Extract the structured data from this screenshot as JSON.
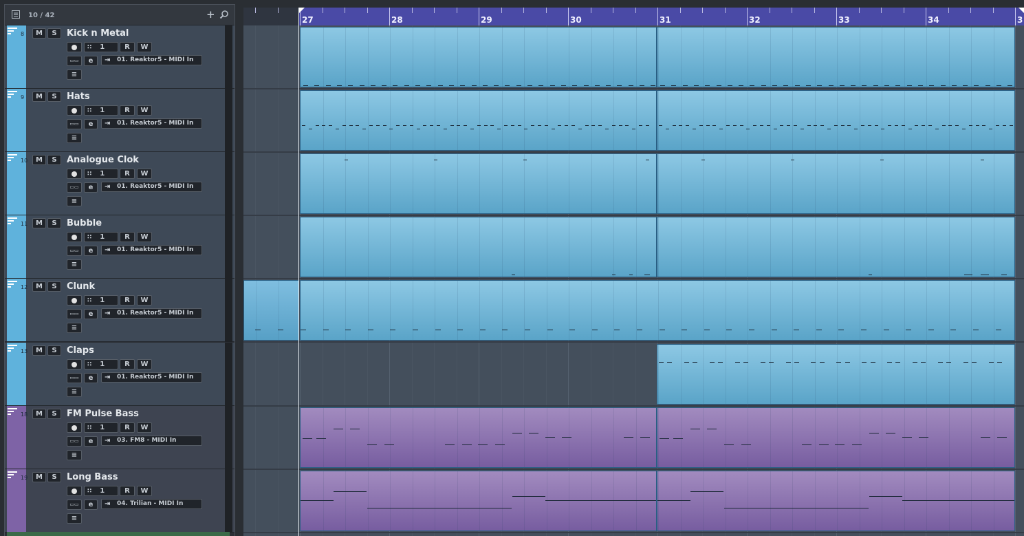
{
  "tracklist": {
    "count": "10 / 42",
    "add_icon": "plus-icon",
    "search_icon": "search-icon",
    "tracks": [
      {
        "num": "8",
        "name": "Kick n Metal",
        "channel": "1",
        "routing": "01. Reaktor5 - MIDI In",
        "color": "#5fb2dc"
      },
      {
        "num": "9",
        "name": "Hats",
        "channel": "1",
        "routing": "01. Reaktor5 - MIDI In",
        "color": "#5fb2dc"
      },
      {
        "num": "10",
        "name": "Analogue Clok",
        "channel": "1",
        "routing": "01. Reaktor5 - MIDI In",
        "color": "#5fb2dc"
      },
      {
        "num": "11",
        "name": "Bubble",
        "channel": "1",
        "routing": "01. Reaktor5 - MIDI In",
        "color": "#5fb2dc"
      },
      {
        "num": "12",
        "name": "Clunk",
        "channel": "1",
        "routing": "01. Reaktor5 - MIDI In",
        "color": "#5fb2dc"
      },
      {
        "num": "13",
        "name": "Claps",
        "channel": "1",
        "routing": "01. Reaktor5 - MIDI In",
        "color": "#5fb2dc"
      },
      {
        "num": "18",
        "name": "FM Pulse Bass",
        "channel": "1",
        "routing": "03. FM8 - MIDI In",
        "color": "#7e63a6"
      },
      {
        "num": "19",
        "name": "Long Bass",
        "channel": "1",
        "routing": "04. Trilian - MIDI In",
        "color": "#7e63a6"
      }
    ],
    "buttons": {
      "mute": "M",
      "solo": "S",
      "read": "R",
      "write": "W",
      "edit": "e"
    }
  },
  "ruler": {
    "bars": [
      "27",
      "28",
      "29",
      "30",
      "31",
      "32",
      "33",
      "34",
      "3"
    ]
  },
  "colors": {
    "blue_part": "#6db4d8",
    "violet_part": "#8a70b0",
    "ruler_active": "#4a4aa6"
  }
}
